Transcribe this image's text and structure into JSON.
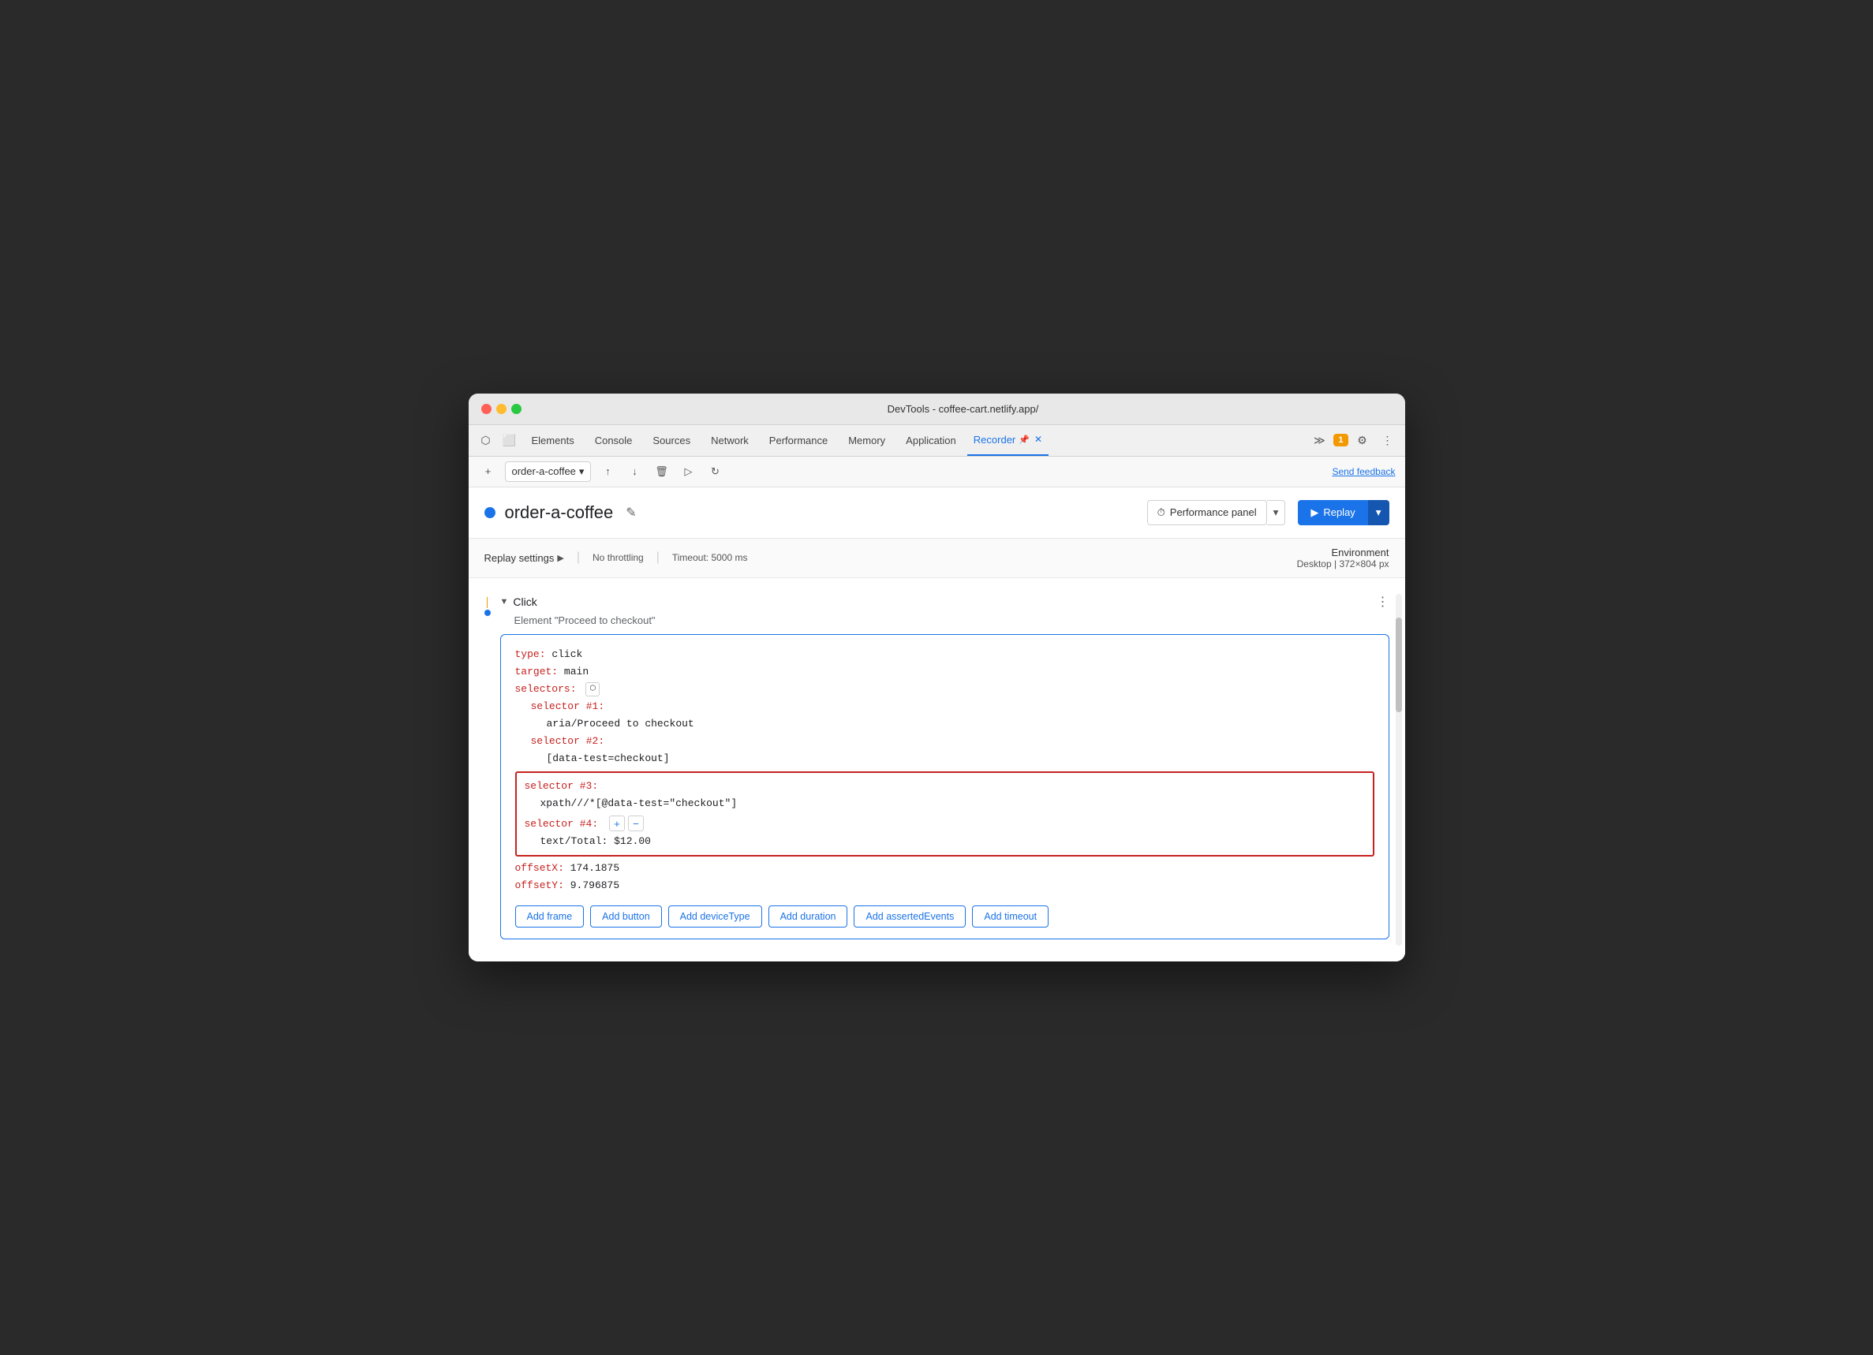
{
  "window": {
    "title": "DevTools - coffee-cart.netlify.app/"
  },
  "tabs": {
    "items": [
      {
        "label": "Elements",
        "active": false
      },
      {
        "label": "Console",
        "active": false
      },
      {
        "label": "Sources",
        "active": false
      },
      {
        "label": "Network",
        "active": false
      },
      {
        "label": "Performance",
        "active": false
      },
      {
        "label": "Memory",
        "active": false
      },
      {
        "label": "Application",
        "active": false
      },
      {
        "label": "Recorder",
        "active": true
      }
    ],
    "notification_count": "1",
    "more_tabs_icon": "≫"
  },
  "toolbar": {
    "new_recording": "+",
    "recording_name": "order-a-coffee",
    "send_feedback": "Send feedback"
  },
  "recording": {
    "title": "order-a-coffee",
    "edit_icon": "✎"
  },
  "replay_settings": {
    "label": "Replay settings",
    "arrow": "▶",
    "throttling": "No throttling",
    "timeout": "Timeout: 5000 ms"
  },
  "environment": {
    "label": "Environment",
    "device": "Desktop",
    "dimensions": "372×804 px"
  },
  "buttons": {
    "performance_panel": "Performance panel",
    "replay": "Replay"
  },
  "step": {
    "type": "Click",
    "description": "Element \"Proceed to checkout\"",
    "code": {
      "type_key": "type:",
      "type_val": "click",
      "target_key": "target:",
      "target_val": "main",
      "selectors_key": "selectors:",
      "selector1_key": "selector #1:",
      "selector1_val": "aria/Proceed to checkout",
      "selector2_key": "selector #2:",
      "selector2_val": "[data-test=checkout]",
      "selector3_key": "selector #3:",
      "selector3_val": "xpath///*[@data-test=\"checkout\"]",
      "selector4_key": "selector #4:",
      "selector4_val": "text/Total: $12.00",
      "offsetX_key": "offsetX:",
      "offsetX_val": "174.1875",
      "offsetY_key": "offsetY:",
      "offsetY_val": "9.796875"
    }
  },
  "action_buttons": [
    "Add frame",
    "Add button",
    "Add deviceType",
    "Add duration",
    "Add assertedEvents",
    "Add timeout"
  ]
}
